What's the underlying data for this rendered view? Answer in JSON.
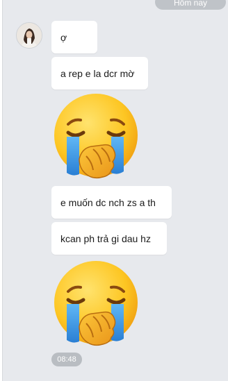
{
  "date_divider": "Hôm nay",
  "messages": [
    {
      "type": "text",
      "text": "ợ"
    },
    {
      "type": "text",
      "text": "a rep e la dcr mờ"
    },
    {
      "type": "emoji",
      "icon": "crying-face-emoji"
    },
    {
      "type": "text",
      "text": "e muốn dc nch zs a th"
    },
    {
      "type": "text",
      "text": "kcan ph trả gi dau hz"
    },
    {
      "type": "emoji",
      "icon": "crying-face-emoji"
    }
  ],
  "timestamp": "08:48",
  "colors": {
    "chat_background": "#e7e9ed",
    "bubble": "#ffffff",
    "pill": "#b9bdc2"
  }
}
